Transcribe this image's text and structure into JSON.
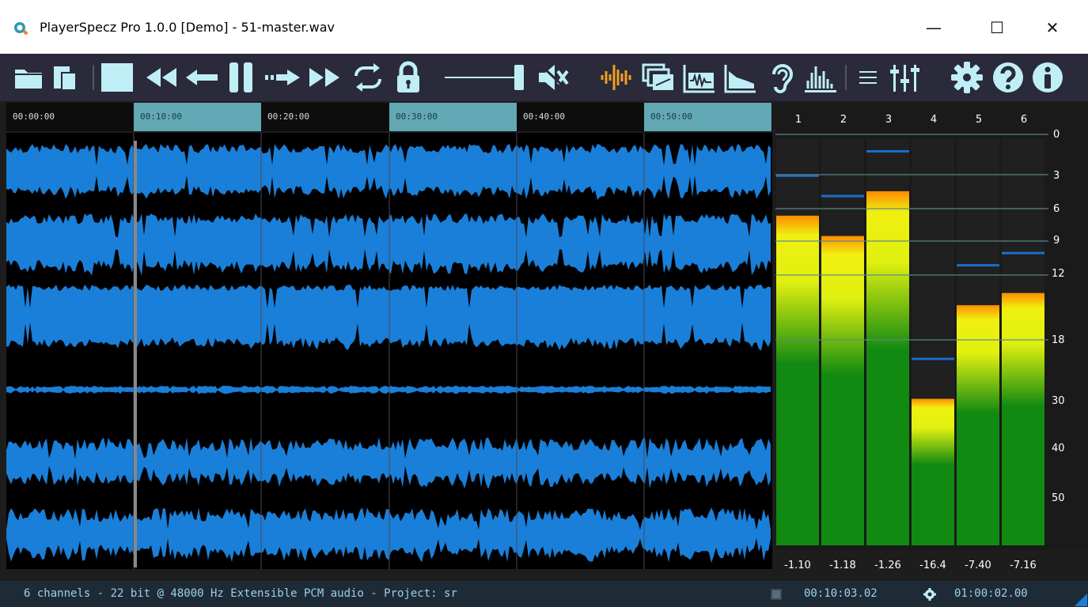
{
  "window": {
    "title": "PlayerSpecz Pro 1.0.0 [Demo] - 51-master.wav",
    "minimize": "—",
    "maximize": "☐",
    "close": "✕"
  },
  "toolbar": {
    "icons": [
      "open-folder-icon",
      "open-files-icon",
      "stop-icon",
      "rewind-icon",
      "step-back-icon",
      "pause-icon",
      "step-forward-icon",
      "fast-forward-icon",
      "loop-icon",
      "lock-icon",
      "volume-slider",
      "mute-icon",
      "waveform-icon",
      "spectrogram-icon",
      "waveform-view-icon",
      "envelope-icon",
      "ear-icon",
      "spectrum-icon",
      "menu-icon",
      "mixer-icon",
      "settings-icon",
      "help-icon",
      "info-icon"
    ],
    "accent_colors": {
      "icon": "#bfeef6",
      "waveform_icon": "#f0a020"
    }
  },
  "timeline": {
    "ticks": [
      "00:00:00",
      "00:10:00",
      "00:20:00",
      "00:30:00",
      "00:40:00",
      "00:50:00"
    ],
    "highlighted": [
      1,
      3,
      5
    ]
  },
  "meters": {
    "channels": [
      "1",
      "2",
      "3",
      "4",
      "5",
      "6"
    ],
    "scale": [
      "0",
      "3",
      "6",
      "9",
      "12",
      "18",
      "30",
      "40",
      "50"
    ],
    "peaks": [
      "-1.10",
      "-1.18",
      "-1.26",
      "-16.4",
      "-7.40",
      "-7.16"
    ],
    "levels_fraction": [
      0.81,
      0.76,
      0.87,
      0.36,
      0.59,
      0.62
    ],
    "colors": {
      "green": "#118a11",
      "yellow": "#f0f010",
      "orange": "#ff8c00",
      "hold": "#1a6ec8"
    }
  },
  "waveform": {
    "color": "#1a7fd8",
    "background": "#000000",
    "playhead_fraction": 0.167
  },
  "status": {
    "text": "6 channels - 22 bit @ 48000 Hz Extensible PCM audio - Project: sr",
    "position": "00:10:03.02",
    "total": "01:00:02.00"
  }
}
